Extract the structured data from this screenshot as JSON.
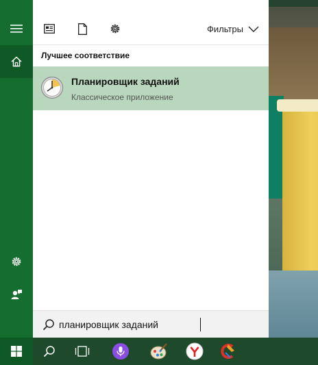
{
  "toolbar": {
    "icons": [
      "news-icon",
      "document-icon",
      "settings-icon"
    ],
    "filters_label": "Фильтры"
  },
  "rail": {
    "icons": [
      "hamburger-icon",
      "home-icon",
      "settings-icon",
      "feedback-icon"
    ]
  },
  "results": {
    "section_title": "Лучшее соответствие",
    "best_match": {
      "name": "Планировщик заданий",
      "kind": "Классическое приложение",
      "icon": "task-scheduler-clock-icon"
    }
  },
  "search": {
    "value": "планировщик заданий",
    "icon": "search-icon"
  },
  "taskbar": {
    "items": [
      "windows-start-icon",
      "search-icon",
      "task-view-icon",
      "cortana-mic-icon",
      "paint-icon",
      "yandex-browser-icon",
      "ccleaner-icon"
    ]
  },
  "colors": {
    "accent": "#156d2f",
    "accent_dark": "#0f5a24",
    "selection": "#b9d7bc",
    "taskbar": "#1e4a2b"
  }
}
